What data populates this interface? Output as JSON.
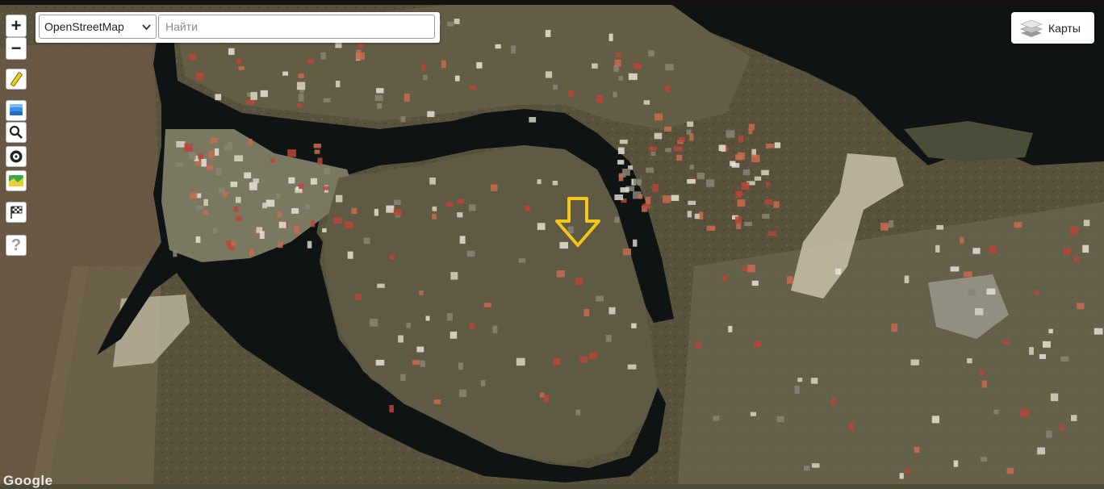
{
  "controls": {
    "zoom_in": "+",
    "zoom_out": "−",
    "help": "?"
  },
  "search": {
    "layer_selected": "OpenStreetMap",
    "placeholder": "Найти"
  },
  "maps_button": {
    "label": "Карты"
  },
  "attribution": "Google",
  "icons": {
    "ruler": "ruler-icon",
    "layers": "layers-icon",
    "search": "search-icon",
    "compass": "compass-icon",
    "map": "map-icon",
    "checkered_flag": "checkered-flag-icon",
    "help": "help-icon",
    "marker": "arrow-down-icon",
    "maps_layers": "stacked-layers-icon"
  },
  "colors": {
    "water": "#0e1414",
    "land": "#5b5540",
    "marker": "#f5c518",
    "roof_red": "#b8453a"
  }
}
